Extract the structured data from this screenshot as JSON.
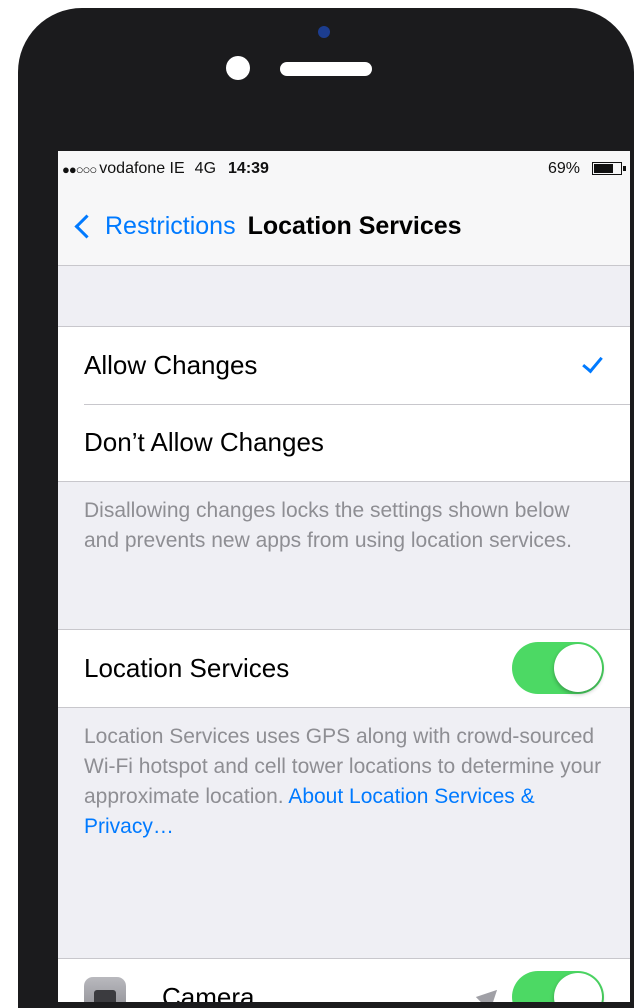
{
  "status_bar": {
    "signal": "●●○○○",
    "carrier": "vodafone IE",
    "network": "4G",
    "time": "14:39",
    "battery": "69%"
  },
  "nav": {
    "back_label": "Restrictions",
    "title": "Location Services"
  },
  "change_options": {
    "allow": "Allow Changes",
    "dont_allow": "Don’t Allow Changes",
    "selected": "allow",
    "footer": "Disallowing changes locks the settings shown below and prevents new apps from using location services."
  },
  "location_services": {
    "label": "Location Services",
    "enabled": true,
    "footer_text": "Location Services uses GPS along with crowd-sourced Wi-Fi hotspot and cell tower locations to determine your approximate location.",
    "footer_link": "About Location Services & Privacy…"
  },
  "apps": [
    {
      "name": "Camera",
      "icon": "camera-icon",
      "enabled": true
    }
  ],
  "colors": {
    "accent": "#007aff",
    "toggle_on": "#4cd964",
    "background": "#efeff4"
  }
}
